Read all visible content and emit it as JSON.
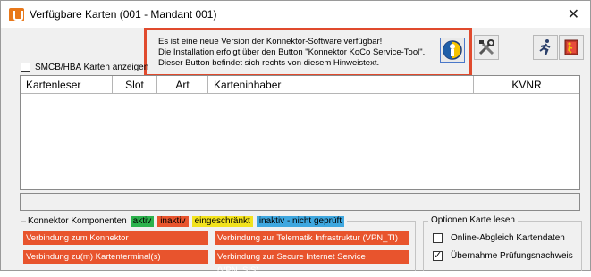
{
  "window": {
    "title": "Verfügbare Karten (001 - Mandant 001)",
    "close": "✕"
  },
  "notice": {
    "lines": [
      "Es ist eine neue Version der Konnektor-Software verfügbar!",
      "Die Installation erfolgt über den Button \"Konnektor KoCo Service-Tool\".",
      "Dieser Button befindet sich rechts von diesem Hinweistext."
    ]
  },
  "toolbar": {
    "icons": [
      "koco-service-tool-icon",
      "settings-tools-icon",
      "run-icon",
      "exit-door-icon"
    ]
  },
  "smcb_checkbox": {
    "label": "SMCB/HBA Karten anzeigen",
    "checked": false
  },
  "table": {
    "columns": [
      "Kartenleser",
      "Slot",
      "Art",
      "Karteninhaber",
      "KVNR"
    ],
    "rows": []
  },
  "components": {
    "legend": "Konnektor Komponenten",
    "tags": [
      {
        "label": "aktiv",
        "color": "#2bb24c"
      },
      {
        "label": "inaktiv",
        "color": "#e8542d"
      },
      {
        "label": "eingeschränkt",
        "color": "#f2e21c"
      },
      {
        "label": "inaktiv - nicht geprüft",
        "color": "#3fa7df"
      }
    ],
    "connections": [
      "Verbindung zum Konnektor",
      "Verbindung zur Telematik Infrastruktur (VPN_TI)",
      "Verbindung zu(m) Kartenterminal(s)",
      "Verbindung zur Secure Internet Service (VPN_SIS)"
    ],
    "status_color": "#e8542d"
  },
  "options": {
    "legend": "Optionen Karte lesen",
    "items": [
      {
        "label": "Online-Abgleich Kartendaten",
        "checked": false
      },
      {
        "label": "Übernahme Prüfungsnachweis",
        "checked": true
      }
    ]
  }
}
